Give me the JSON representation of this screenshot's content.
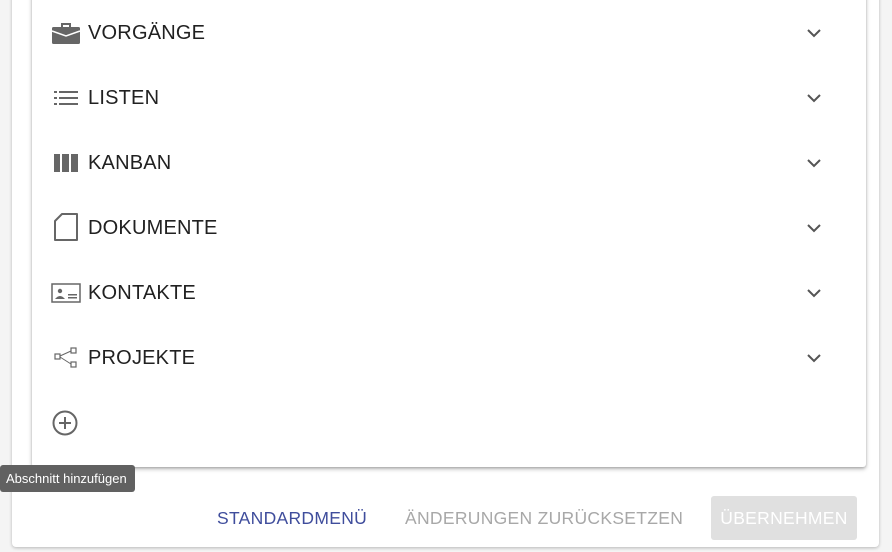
{
  "sections": [
    {
      "label": "VORGÄNGE",
      "icon": "briefcase-icon"
    },
    {
      "label": "LISTEN",
      "icon": "list-icon"
    },
    {
      "label": "KANBAN",
      "icon": "kanban-icon"
    },
    {
      "label": "DOKUMENTE",
      "icon": "document-icon"
    },
    {
      "label": "KONTAKTE",
      "icon": "contact-card-icon"
    },
    {
      "label": "PROJEKTE",
      "icon": "project-tree-icon"
    }
  ],
  "add_section": {
    "icon": "add-circle-icon",
    "tooltip": "Abschnitt hinzufügen"
  },
  "actions": {
    "default_menu": "STANDARDMENÜ",
    "reset_changes": "ÄNDERUNGEN ZURÜCKSETZEN",
    "apply": "ÜBERNEHMEN"
  },
  "colors": {
    "primary_text": "#212121",
    "icon": "#666666",
    "link_button": "#3f4d9c",
    "disabled_text": "#a8a8a8",
    "disabled_bg": "#e0e0e0",
    "tooltip_bg": "#616161"
  }
}
